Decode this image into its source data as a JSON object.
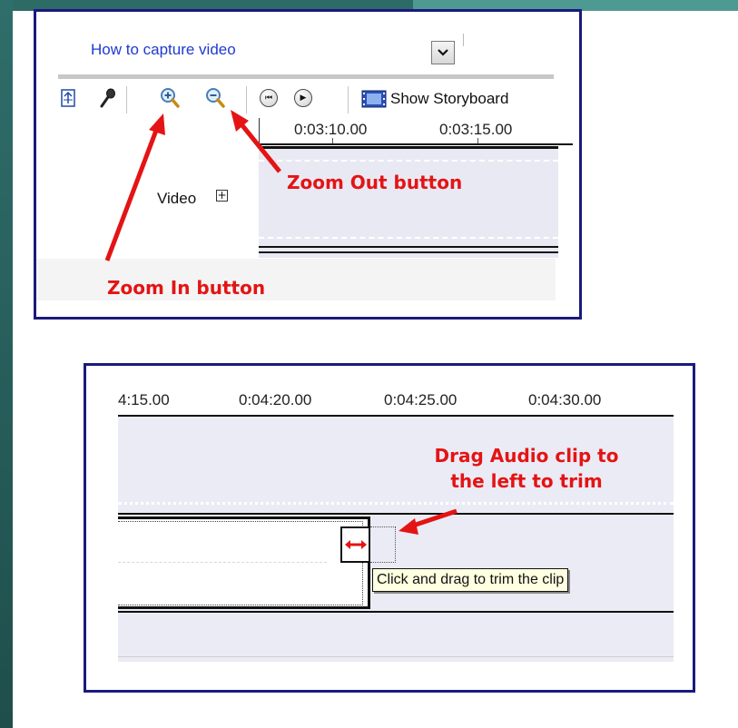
{
  "panel_top": {
    "title": "How to capture video",
    "dropdown_glyph": "⌄",
    "toolbar": {
      "icons": [
        "storyboard-toggle-icon",
        "narrate-icon",
        "zoom-in-icon",
        "zoom-out-icon",
        "rewind-icon",
        "play-icon",
        "film-icon"
      ],
      "show_storyboard_label": "Show Storyboard"
    },
    "ruler": {
      "ticks": [
        "0:03:10.00",
        "0:03:15.00"
      ]
    },
    "track": {
      "label": "Video",
      "expand_glyph": "+"
    },
    "annotations": {
      "zoom_in": "Zoom In button",
      "zoom_out": "Zoom Out button"
    },
    "colors": {
      "annotation": "#e41414",
      "border": "#1a1a7c",
      "title": "#1e3ad1"
    }
  },
  "panel_bottom": {
    "ruler": {
      "ticks": [
        "4:15.00",
        "0:04:20.00",
        "0:04:25.00",
        "0:04:30.00"
      ]
    },
    "annotation_line1": "Drag Audio clip to",
    "annotation_line2": "the left to trim",
    "tooltip": "Click and drag to trim the clip",
    "handle_glyph": "↔"
  }
}
